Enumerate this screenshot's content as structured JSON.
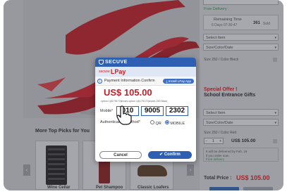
{
  "right_panel": {
    "delivery_label": "Free Delivery",
    "remaining_label": "Remaining Time",
    "remaining_time": "6 Days 07:30:47",
    "sold_count": "361",
    "sold_label": "Sold",
    "select_item_1": "Select Item",
    "size_color_1": "Size/Color/Date",
    "size_info_1": "Size 250 / Color Black",
    "special_offer_title": "Special Offer !",
    "gift_title": "School Entrance Gifts",
    "select_item_2": "Select Item",
    "size_color_2": "Size/Color/Date",
    "size_info_2": "Size 250 / Color Red",
    "quantity": "1",
    "line_price": "US$ 105.00",
    "delivery_note_1": "It will be delivered by Feb. 19",
    "delivery_note_2": "if you order now.",
    "delivery_note_3": "Free delivery",
    "total_label": "Total Price :",
    "total_price": "US$ 105.00"
  },
  "recommendations": {
    "title": "More Top Picks for You",
    "items": [
      {
        "label": "Wine Cellar"
      },
      {
        "label": "Pet Shampoo"
      },
      {
        "label": "Classic Loafers"
      }
    ]
  },
  "modal": {
    "vendor": "SECUVE",
    "brand_small": "secuve",
    "brand_big": "LPay",
    "info_title": "Payment Information Confirm",
    "install_label": "Install LPay App",
    "amount": "US$ 105.00",
    "option_text": "option 1|6175172|shoes option 1|6175172|shoes 250 Black",
    "mobile_label": "Mobile",
    "mobile_parts": [
      "010",
      "9005",
      "2302"
    ],
    "auth_label": "Authentication Method",
    "auth_options": [
      "QR",
      "MOBILE"
    ],
    "auth_selected": "MOBILE",
    "cancel_label": "Cancel",
    "confirm_label": "Confirm"
  },
  "colors": {
    "accent": "#2e5fb3",
    "price_red": "#d02020",
    "delivery_green": "#2a9d3a"
  }
}
